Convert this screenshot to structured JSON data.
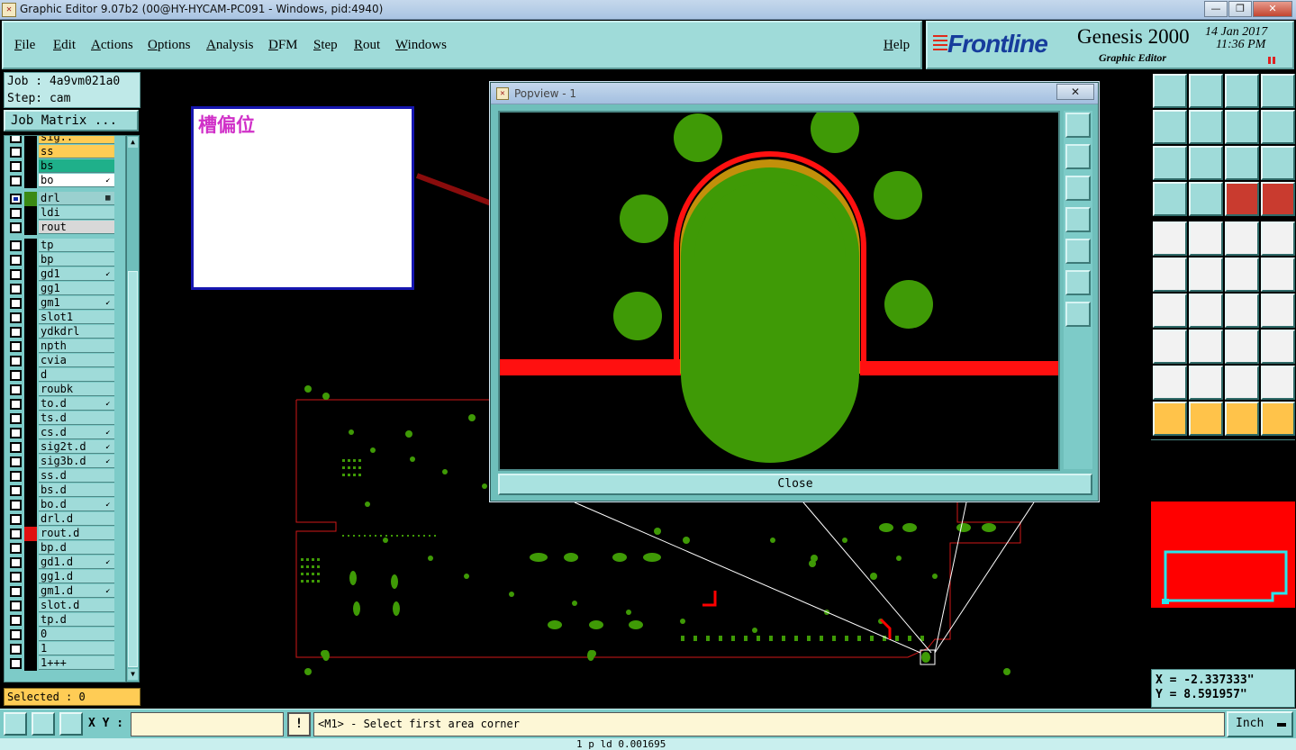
{
  "window": {
    "title": "Graphic Editor 9.07b2 (00@HY-HYCAM-PC091 - Windows, pid:4940)",
    "minimize": "—",
    "maximize": "❐",
    "close": "✕"
  },
  "menu": {
    "items": [
      "File",
      "Edit",
      "Actions",
      "Options",
      "Analysis",
      "DFM",
      "Step",
      "Rout",
      "Windows"
    ],
    "help": "Help"
  },
  "brand": {
    "logo": "Frontline",
    "product": "Genesis 2000",
    "subtitle": "Graphic Editor",
    "date": "14 Jan 2017",
    "time": "11:36 PM"
  },
  "job": {
    "job_line": "Job : 4a9vm021a0",
    "step_line": "Step: cam",
    "matrix_button": "Job Matrix ..."
  },
  "layers": [
    {
      "name": "sig..",
      "color": "#ffcc55",
      "checked": false
    },
    {
      "name": "ss",
      "color": "#ffcc55",
      "checked": false
    },
    {
      "name": "bs",
      "color": "#1fb08a",
      "checked": false
    },
    {
      "name": "bo",
      "color": "#ffffff",
      "checked": false,
      "flag": "↙"
    },
    {
      "name": "drl",
      "color": "#9ad0cf",
      "checked": true,
      "swatch": "#3b8a14",
      "flag": "▦"
    },
    {
      "name": "ldi",
      "color": "#9fdbd9",
      "checked": false
    },
    {
      "name": "rout",
      "color": "#d8d8d8",
      "checked": false
    },
    {
      "name": "tp",
      "checked": false
    },
    {
      "name": "bp",
      "checked": false
    },
    {
      "name": "gd1",
      "checked": false,
      "flag": "↙"
    },
    {
      "name": "gg1",
      "checked": false
    },
    {
      "name": "gm1",
      "checked": false,
      "flag": "↙"
    },
    {
      "name": "slot1",
      "checked": false
    },
    {
      "name": "ydkdrl",
      "checked": false
    },
    {
      "name": "npth",
      "checked": false
    },
    {
      "name": "cvia",
      "checked": false
    },
    {
      "name": "d",
      "checked": false
    },
    {
      "name": "roubk",
      "checked": false
    },
    {
      "name": "to.d",
      "checked": false,
      "flag": "↙"
    },
    {
      "name": "ts.d",
      "checked": false
    },
    {
      "name": "cs.d",
      "checked": false,
      "flag": "↙"
    },
    {
      "name": "sig2t.d",
      "checked": false,
      "flag": "↙"
    },
    {
      "name": "sig3b.d",
      "checked": false,
      "flag": "↙"
    },
    {
      "name": "ss.d",
      "checked": false
    },
    {
      "name": "bs.d",
      "checked": false
    },
    {
      "name": "bo.d",
      "checked": false,
      "flag": "↙"
    },
    {
      "name": "drl.d",
      "checked": false
    },
    {
      "name": "rout.d",
      "checked": false,
      "swatch": "#e01010"
    },
    {
      "name": "bp.d",
      "checked": false
    },
    {
      "name": "gd1.d",
      "checked": false,
      "flag": "↙"
    },
    {
      "name": "gg1.d",
      "checked": false
    },
    {
      "name": "gm1.d",
      "checked": false,
      "flag": "↙"
    },
    {
      "name": "slot.d",
      "checked": false
    },
    {
      "name": "tp.d",
      "checked": false
    },
    {
      "name": "0",
      "checked": false
    },
    {
      "name": "1",
      "checked": false
    },
    {
      "name": "1+++",
      "checked": false
    }
  ],
  "selected": "Selected : 0",
  "annotation": {
    "text": "槽偏位"
  },
  "popview": {
    "title": "Popview - 1",
    "close_x": "✕",
    "close_button": "Close"
  },
  "coords": {
    "x": "X = -2.337333\"",
    "y": "Y = 8.591957\""
  },
  "bottom": {
    "xy_label": "X Y :",
    "xy_value": "",
    "info_button": "!",
    "prompt": "<M1> - Select first area corner",
    "unit": "Inch",
    "status": "1 p ld  0.001695"
  },
  "colors": {
    "panel": "#9fdbd9",
    "panel_dark": "#7dcbc8",
    "pad_green": "#3f9a06",
    "rout_red": "#ff0000",
    "annotation_pink": "#d030c8",
    "annotation_border": "#1616b0"
  }
}
